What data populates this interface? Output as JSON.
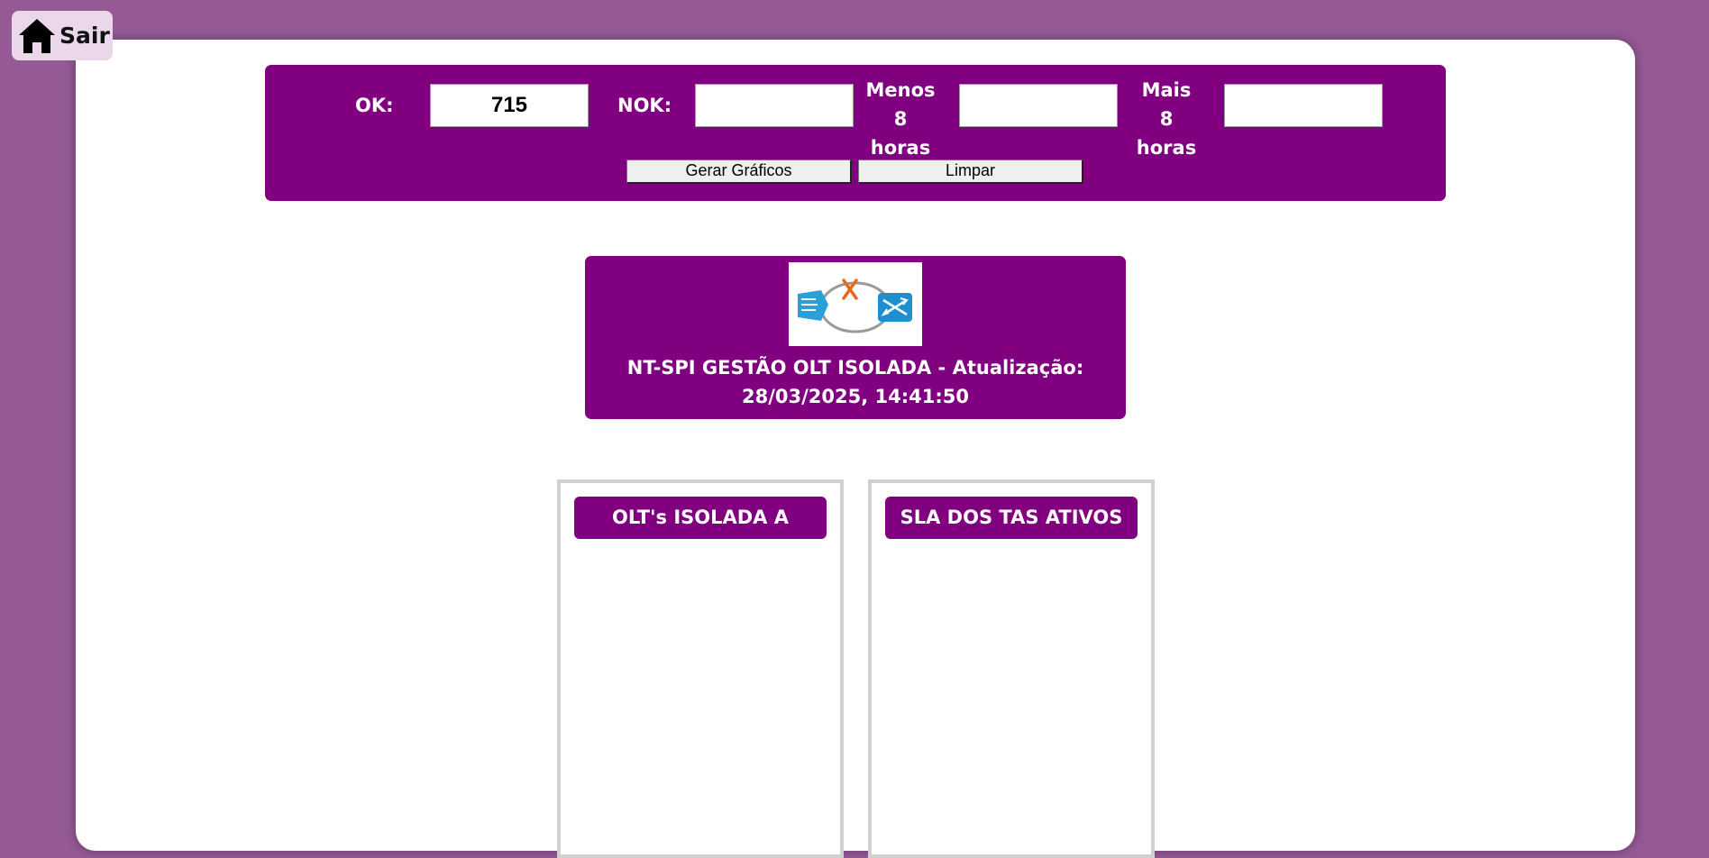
{
  "nav": {
    "sair_label": "Sair",
    "home_icon": "home-icon"
  },
  "filters": {
    "ok_label": "OK:",
    "ok_value": "715",
    "nok_label": "NOK:",
    "nok_value": "",
    "menos_label_line1": "Menos",
    "menos_label_line2": "8 horas",
    "menos_value": "",
    "mais_label_line1": "Mais",
    "mais_label_line2": "8 horas",
    "mais_value": "",
    "gerar_button": "Gerar Gráficos",
    "limpar_button": "Limpar"
  },
  "header": {
    "logo_icon": "network-isolated-icon",
    "title_line1": "NT-SPI GESTÃO OLT ISOLADA - Atualização:",
    "title_line2": "28/03/2025, 14:41:50"
  },
  "charts": [
    {
      "title": "OLT's ISOLADA A"
    },
    {
      "title": "SLA DOS TAS ATIVOS"
    }
  ],
  "colors": {
    "background": "#955a95",
    "accent": "#800080",
    "card": "#ffffff",
    "sair_button_bg": "#ead8ea"
  }
}
